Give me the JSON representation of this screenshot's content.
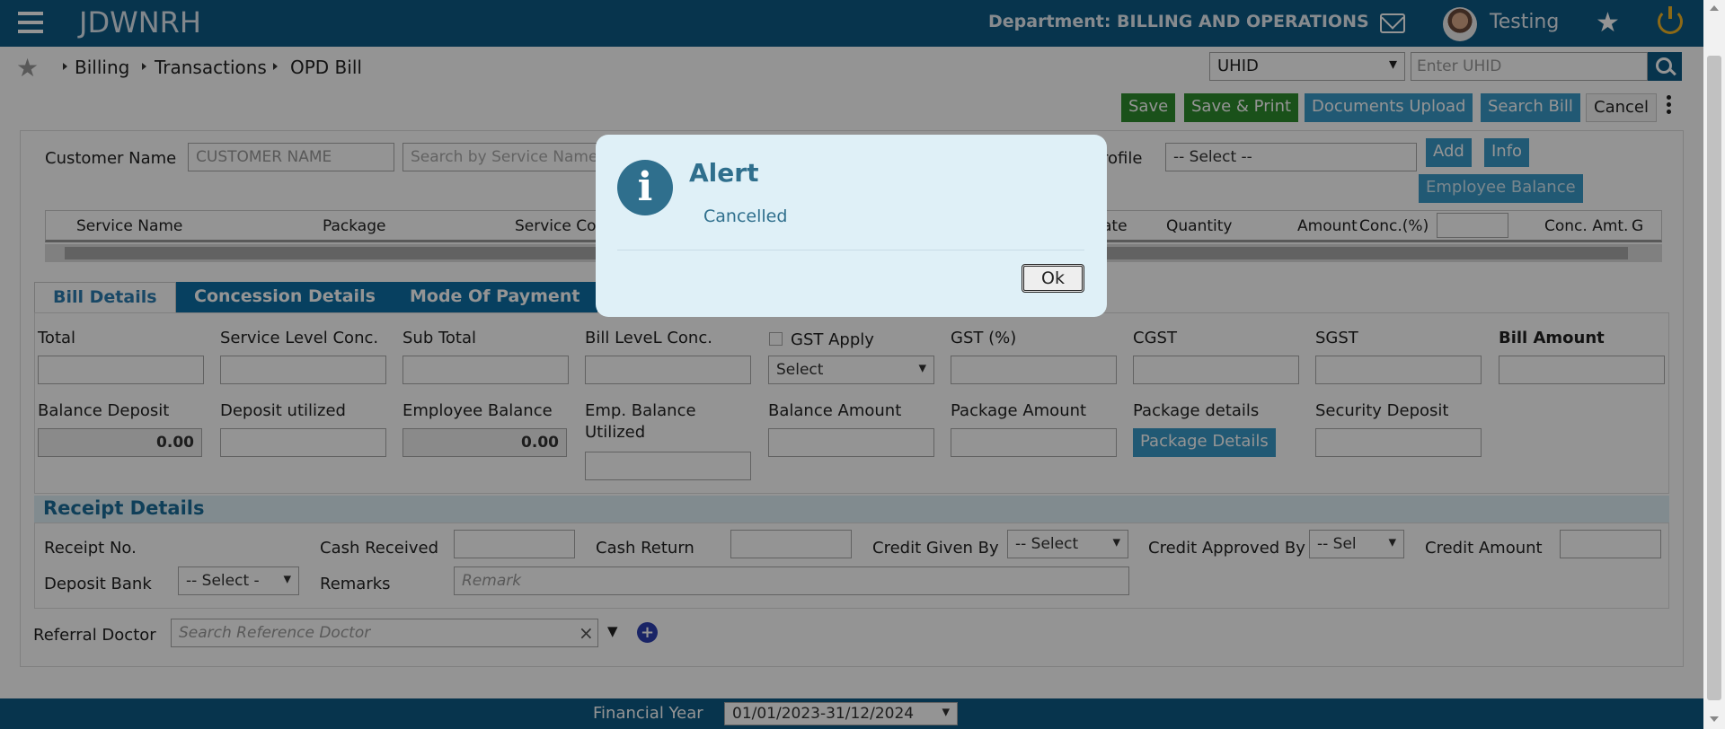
{
  "app": {
    "title": "JDWNRH",
    "department": "Department: BILLING AND OPERATIONS",
    "user": "Testing"
  },
  "breadcrumb": {
    "items": [
      "Billing",
      "Transactions",
      "OPD Bill"
    ]
  },
  "uhid": {
    "type": "UHID",
    "placeholder": "Enter UHID"
  },
  "actions": {
    "save": "Save",
    "save_print": "Save & Print",
    "documents_upload": "Documents Upload",
    "search_bill": "Search Bill",
    "cancel": "Cancel"
  },
  "customer": {
    "label": "Customer Name",
    "name_placeholder": "CUSTOMER NAME",
    "service_placeholder": "Search by Service Name",
    "profile_label": "rofile",
    "profile_select": "-- Select --",
    "add": "Add",
    "info": "Info",
    "employee_balance": "Employee Balance"
  },
  "grid": {
    "columns": [
      "Service Name",
      "Package",
      "Service Co",
      "ate",
      "Quantity",
      "Amount",
      "Conc.(%)",
      "Conc. Amt.",
      "G"
    ]
  },
  "tabs": [
    "Bill Details",
    "Concession Details",
    "Mode Of Payment"
  ],
  "bill": {
    "total": "Total",
    "service_level_conc": "Service Level Conc.",
    "sub_total": "Sub Total",
    "bill_level_conc": "Bill LeveL Conc.",
    "gst_apply": "GST Apply",
    "gst_select": "Select",
    "gst_pct": "GST (%)",
    "cgst": "CGST",
    "sgst": "SGST",
    "bill_amount": "Bill Amount",
    "balance_deposit": "Balance Deposit",
    "balance_deposit_value": "0.00",
    "deposit_utilized": "Deposit utilized",
    "employee_balance": "Employee Balance",
    "employee_balance_value": "0.00",
    "emp_balance_utilized_1": "Emp. Balance",
    "emp_balance_utilized_2": "Utilized",
    "balance_amount": "Balance Amount",
    "package_amount": "Package Amount",
    "package_details": "Package details",
    "package_details_btn": "Package Details",
    "security_deposit": "Security Deposit"
  },
  "receipt": {
    "title": "Receipt Details",
    "receipt_no": "Receipt No.",
    "cash_received": "Cash Received",
    "cash_return": "Cash Return",
    "credit_given_by": "Credit Given By",
    "credit_given_select": "-- Select",
    "credit_approved_by": "Credit Approved By",
    "credit_approved_select": "-- Sel",
    "credit_amount": "Credit Amount",
    "deposit_bank": "Deposit Bank",
    "deposit_bank_select": "-- Select -",
    "remarks": "Remarks",
    "remark_placeholder": "Remark"
  },
  "referral": {
    "label": "Referral Doctor",
    "placeholder": "Search Reference Doctor"
  },
  "footer": {
    "label": "Financial Year",
    "value": "01/01/2023-31/12/2024"
  },
  "alert": {
    "title": "Alert",
    "message": "Cancelled",
    "ok": "Ok"
  },
  "colors": {
    "header": "#0d5a86",
    "green": "#2e8c2e",
    "blue": "#3a9ac9",
    "alert_bg": "#dff0f7"
  }
}
